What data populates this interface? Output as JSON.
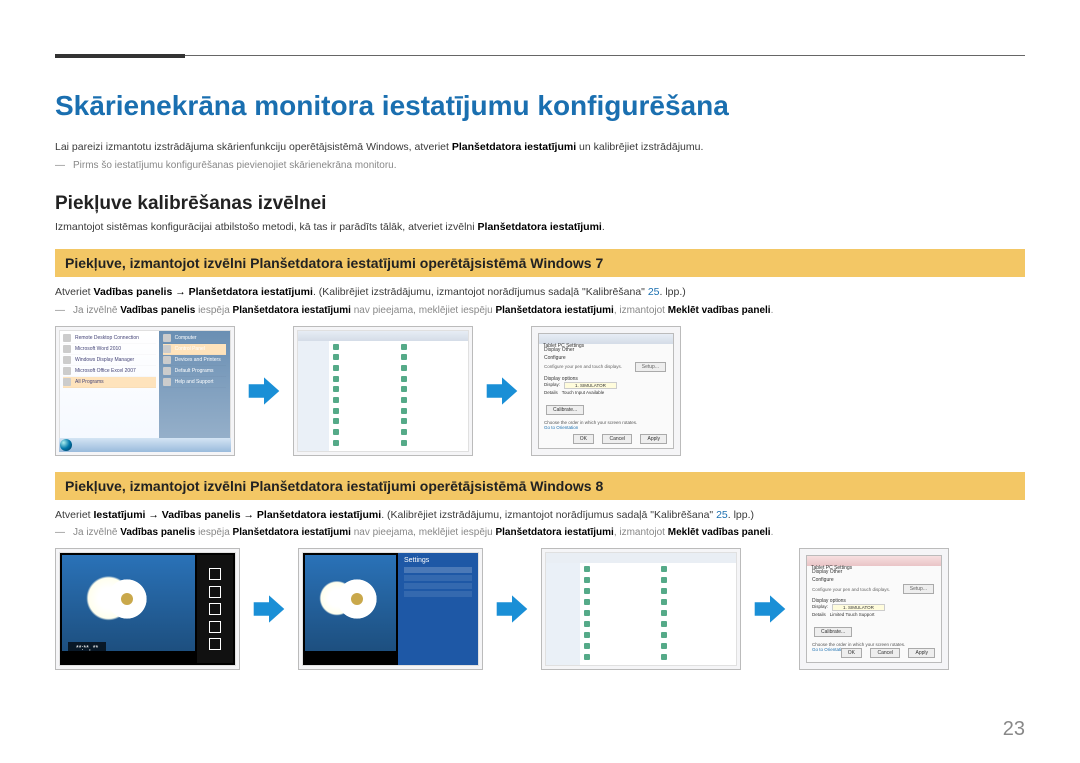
{
  "page": {
    "number": "23",
    "h1": "Skārienekrāna monitora iestatījumu konfigurēšana",
    "intro_pre": "Lai pareizi izmantotu izstrādājuma skārienfunkciju operētājsistēmā Windows, atveriet ",
    "intro_bold": "Planšetdatora iestatījumi",
    "intro_post": " un kalibrējiet izstrādājumu.",
    "note1": "Pirms šo iestatījumu konfigurēšanas pievienojiet skārienekrāna monitoru.",
    "h2": "Piekļuve kalibrēšanas izvēlnei",
    "sub_pre": "Izmantojot sistēmas konfigurācijai atbilstošo metodi, kā tas ir parādīts tālāk, atveriet izvēlni ",
    "sub_bold": "Planšetdatora iestatījumi",
    "sub_post": "."
  },
  "win7": {
    "band": "Piekļuve, izmantojot izvēlni Planšetdatora iestatījumi operētājsistēmā Windows 7",
    "p_pre": "Atveriet ",
    "p_b1": "Vadības panelis → Planšetdatora iestatījumi",
    "p_mid": ". (Kalibrējiet izstrādājumu, izmantojot norādījumus sadaļā \"Kalibrēšana\" ",
    "p_link": "25",
    "p_post": ". lpp.)",
    "n_pre": "Ja izvēlnē ",
    "n_b1": "Vadības panelis",
    "n_mid1": " iespēja ",
    "n_b2": "Planšetdatora iestatījumi",
    "n_mid2": " nav pieejama, meklējiet iespēju ",
    "n_b3": "Planšetdatora iestatījumi",
    "n_mid3": ", izmantojot ",
    "n_b4": "Meklēt vadības paneli",
    "n_post": ".",
    "start": {
      "left": [
        "Remote Desktop Connection",
        "Microsoft Word 2010",
        "Windows Display Manager",
        "Microsoft Office Excel 2007",
        "All Programs"
      ],
      "right": [
        "Computer",
        "Control Panel",
        "Devices and Printers",
        "Default Programs",
        "Help and Support"
      ]
    },
    "tablet": {
      "title": "Tablet PC Settings",
      "tabs": "Display   Other",
      "conf": "Configure",
      "conftext": "Configure your pen and touch displays.",
      "setup": "Setup...",
      "dispopt": "Display options",
      "display": "Display:",
      "dispval": "1. SIMULATOR",
      "calibrate": "Calibrate...",
      "details": "Details",
      "touch": "Touch Input Available",
      "order": "Choose the order in which your screen rotates.",
      "goto": "Go to Orientation",
      "ok": "OK",
      "cancel": "Cancel",
      "apply": "Apply"
    }
  },
  "win8": {
    "band": "Piekļuve, izmantojot izvēlni Planšetdatora iestatījumi operētājsistēmā Windows 8",
    "p_pre": "Atveriet ",
    "p_b1": "Iestatījumi → Vadības panelis → Planšetdatora iestatījumi",
    "p_mid": ". (Kalibrējiet izstrādājumu, izmantojot norādījumus sadaļā \"Kalibrēšana\" ",
    "p_link": "25",
    "p_post": ". lpp.)",
    "n_pre": "Ja izvēlnē ",
    "n_b1": "Vadības panelis",
    "n_mid1": " iespēja ",
    "n_b2": "Planšetdatora iestatījumi",
    "n_mid2": " nav pieejama, meklējiet iespēju ",
    "n_b3": "Planšetdatora iestatījumi",
    "n_mid3": ", izmantojot ",
    "n_b4": "Meklēt vadības paneli",
    "n_post": ".",
    "clock": "**:**, **",
    "settings_title": "Settings",
    "tablet": {
      "touch": "Limited Touch Support"
    }
  }
}
